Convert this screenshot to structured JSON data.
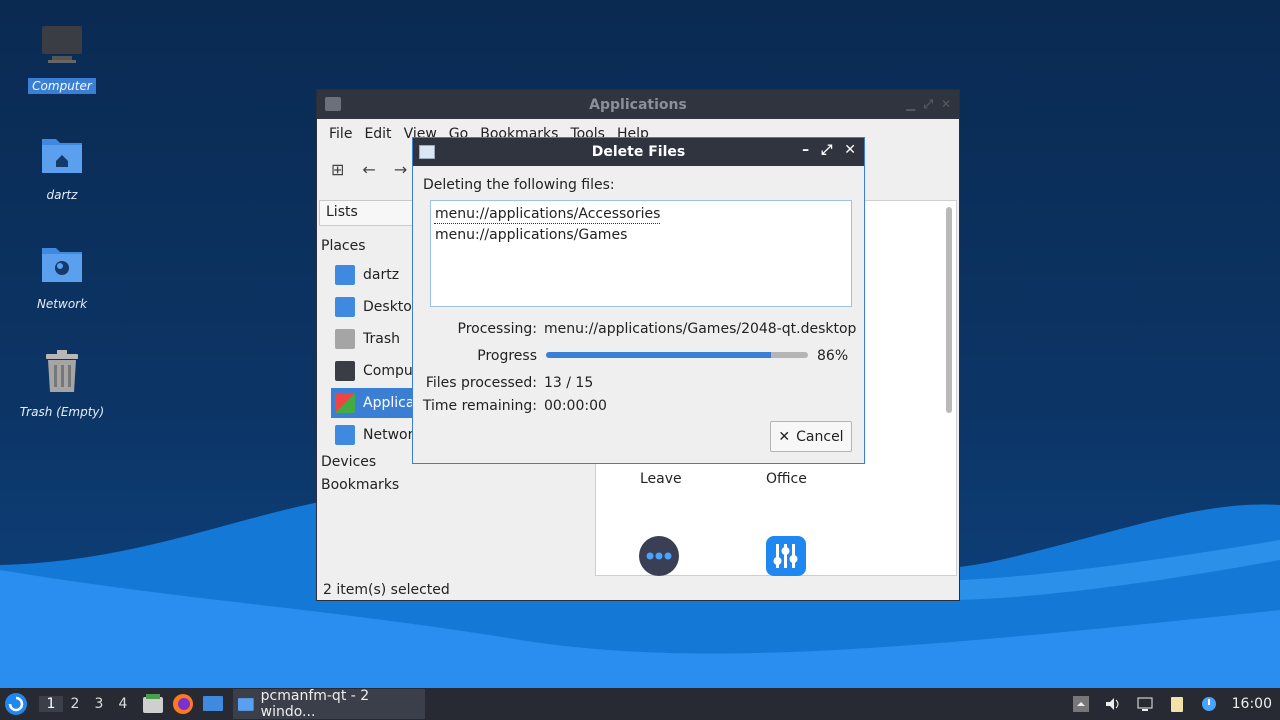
{
  "desktop": {
    "icons": [
      {
        "label": "Computer",
        "icon": "computer-icon",
        "selected": true
      },
      {
        "label": "dartz",
        "icon": "home-folder-icon",
        "selected": false
      },
      {
        "label": "Network",
        "icon": "network-folder-icon",
        "selected": false
      },
      {
        "label": "Trash (Empty)",
        "icon": "trash-icon",
        "selected": false
      }
    ]
  },
  "file_manager": {
    "title": "Applications",
    "menu": [
      "File",
      "Edit",
      "View",
      "Go",
      "Bookmarks",
      "Tools",
      "Help"
    ],
    "side_combo": "Lists",
    "places_header": "Places",
    "places": [
      {
        "label": "dartz",
        "icon": "home-folder-icon"
      },
      {
        "label": "Deskto",
        "icon": "desktop-icon"
      },
      {
        "label": "Trash",
        "icon": "trash-icon"
      },
      {
        "label": "Compu",
        "icon": "computer-icon"
      },
      {
        "label": "Applica",
        "icon": "applications-icon",
        "active": true
      },
      {
        "label": "Networ",
        "icon": "network-folder-icon"
      }
    ],
    "devices_header": "Devices",
    "bookmarks_header": "Bookmarks",
    "content_items": [
      {
        "label": "Leave",
        "icon": "leave-icon"
      },
      {
        "label": "Office",
        "icon": "office-icon"
      }
    ],
    "status": "2 item(s) selected"
  },
  "dialog": {
    "title": "Delete Files",
    "heading": "Deleting the following files:",
    "files": [
      "menu://applications/Accessories",
      "menu://applications/Games"
    ],
    "processing_label": "Processing:",
    "processing_value": "menu://applications/Games/2048-qt.desktop",
    "progress_label": "Progress",
    "progress_percent": 86,
    "progress_text": "86%",
    "files_processed_label": "Files processed:",
    "files_processed_value": "13 / 15",
    "time_remaining_label": "Time remaining:",
    "time_remaining_value": "00:00:00",
    "cancel_label": "Cancel"
  },
  "taskbar": {
    "workspaces": [
      "1",
      "2",
      "3",
      "4"
    ],
    "active_workspace": "1",
    "task_label": "pcmanfm-qt - 2 windo...",
    "clock": "16:00"
  },
  "colors": {
    "accent": "#3b7fd4",
    "titlebar": "#2f343f",
    "taskbar": "#272a33"
  }
}
